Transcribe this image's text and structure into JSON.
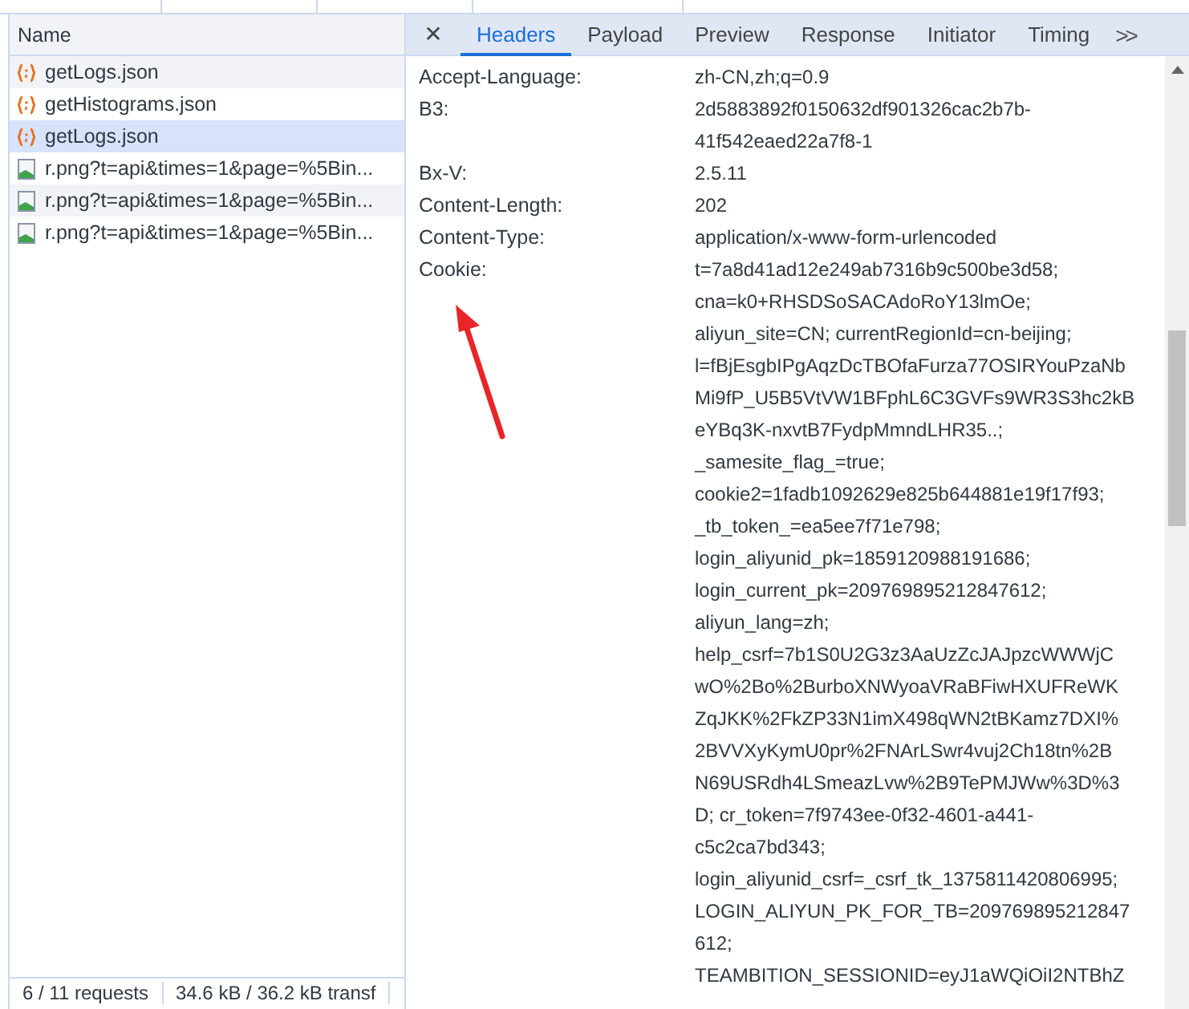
{
  "requests": {
    "column": "Name",
    "rows": [
      {
        "kind": "json",
        "name": "getLogs.json",
        "selected": false
      },
      {
        "kind": "json",
        "name": "getHistograms.json",
        "selected": false
      },
      {
        "kind": "json",
        "name": "getLogs.json",
        "selected": true
      },
      {
        "kind": "image",
        "name": "r.png?t=api&times=1&page=%5Bin...",
        "selected": false
      },
      {
        "kind": "image",
        "name": "r.png?t=api&times=1&page=%5Bin...",
        "selected": false
      },
      {
        "kind": "image",
        "name": "r.png?t=api&times=1&page=%5Bin...",
        "selected": false
      }
    ]
  },
  "status_bar": [
    "6 / 11 requests",
    "34.6 kB / 36.2 kB transf"
  ],
  "details": {
    "close": "✕",
    "more": ">>",
    "tabs": [
      {
        "label": "Headers",
        "selected": true
      },
      {
        "label": "Payload",
        "selected": false
      },
      {
        "label": "Preview",
        "selected": false
      },
      {
        "label": "Response",
        "selected": false
      },
      {
        "label": "Initiator",
        "selected": false
      },
      {
        "label": "Timing",
        "selected": false
      }
    ],
    "headers": [
      {
        "name": "Accept-Language:",
        "lines": [
          "zh-CN,zh;q=0.9"
        ]
      },
      {
        "name": "B3:",
        "lines": [
          "2d5883892f0150632df901326cac2b7b-",
          "41f542eaed22a7f8-1"
        ]
      },
      {
        "name": "Bx-V:",
        "lines": [
          "2.5.11"
        ]
      },
      {
        "name": "Content-Length:",
        "lines": [
          "202"
        ]
      },
      {
        "name": "Content-Type:",
        "lines": [
          "application/x-www-form-urlencoded"
        ]
      },
      {
        "name": "Cookie:",
        "lines": [
          "t=7a8d41ad12e249ab7316b9c500be3d58;",
          "cna=k0+RHSDSoSACAdoRoY13lmOe;",
          "aliyun_site=CN; currentRegionId=cn-beijing;",
          "l=fBjEsgbIPgAqzDcTBOfaFurza77OSIRYouPzaNb",
          "Mi9fP_U5B5VtVW1BFphL6C3GVFs9WR3S3hc2kB",
          "eYBq3K-nxvtB7FydpMmndLHR35..;",
          "_samesite_flag_=true;",
          "cookie2=1fadb1092629e825b644881e19f17f93;",
          "_tb_token_=ea5ee7f71e798;",
          "login_aliyunid_pk=1859120988191686;",
          "login_current_pk=209769895212847612;",
          "aliyun_lang=zh;",
          "help_csrf=7b1S0U2G3z3AaUzZcJAJpzcWWWjC",
          "wO%2Bo%2BurboXNWyoaVRaBFiwHXUFReWK",
          "ZqJKK%2FkZP33N1imX498qWN2tBKamz7DXI%",
          "2BVVXyKymU0pr%2FNArLSwr4vuj2Ch18tn%2B",
          "N69USRdh4LSmeazLvw%2B9TePMJWw%3D%3",
          "D; cr_token=7f9743ee-0f32-4601-a441-",
          "c5c2ca7bd343;",
          "login_aliyunid_csrf=_csrf_tk_1375811420806995;",
          "LOGIN_ALIYUN_PK_FOR_TB=209769895212847",
          "612;",
          "TEAMBITION_SESSIONID=eyJ1aWQiOiI2NTBhZ"
        ]
      }
    ]
  }
}
